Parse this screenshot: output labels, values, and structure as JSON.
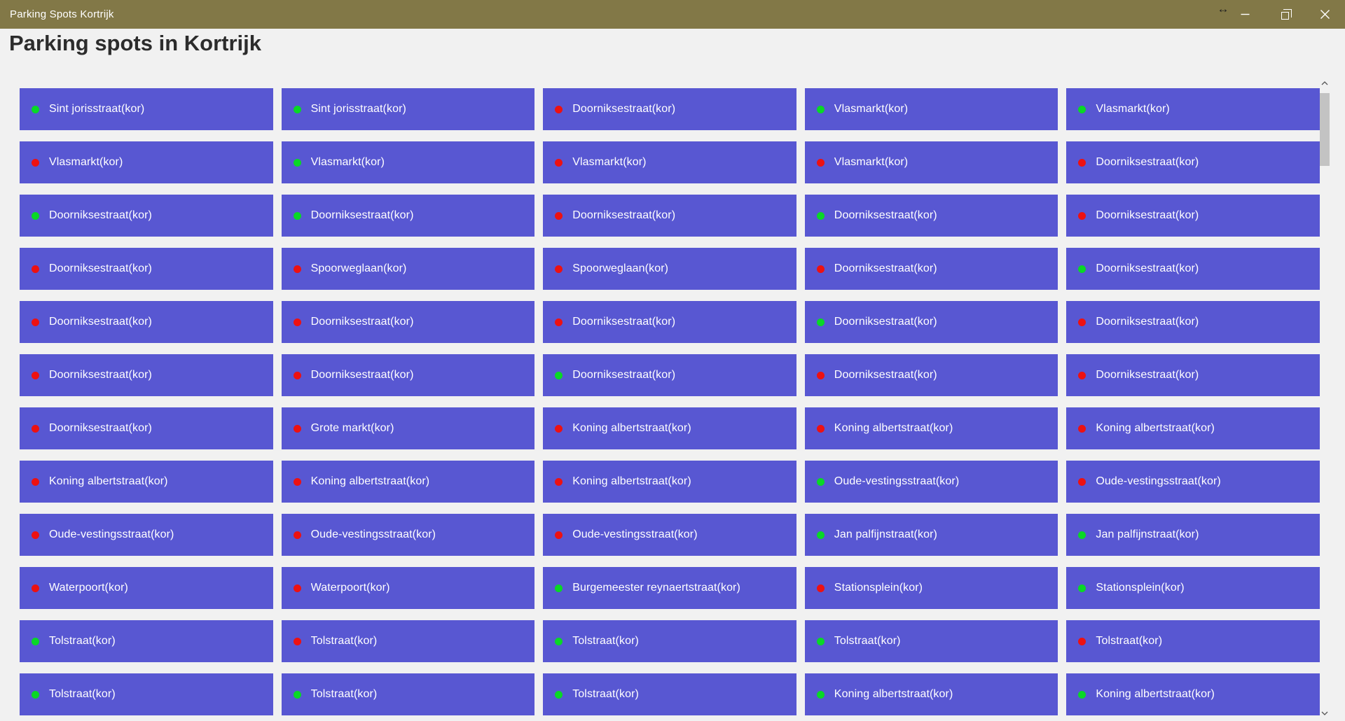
{
  "window": {
    "title": "Parking Spots Kortrijk",
    "controls": {
      "minimize": "minimize",
      "restore": "restore",
      "close": "close"
    },
    "cursor_glyph": "↔"
  },
  "page": {
    "heading": "Parking spots in Kortrijk"
  },
  "colors": {
    "titlebar": "#827847",
    "page_bg": "#f1f1f1",
    "button_bg": "#5857d2",
    "button_text": "#ffffff",
    "dot_green": "#09d826",
    "dot_red": "#ed1111",
    "scroll_thumb": "#c3c3c3"
  },
  "spots": [
    {
      "label": "Sint jorisstraat(kor)",
      "dot": "green"
    },
    {
      "label": "Sint jorisstraat(kor)",
      "dot": "green"
    },
    {
      "label": "Doorniksestraat(kor)",
      "dot": "red"
    },
    {
      "label": "Vlasmarkt(kor)",
      "dot": "green"
    },
    {
      "label": "Vlasmarkt(kor)",
      "dot": "green"
    },
    {
      "label": "Vlasmarkt(kor)",
      "dot": "red"
    },
    {
      "label": "Vlasmarkt(kor)",
      "dot": "green"
    },
    {
      "label": "Vlasmarkt(kor)",
      "dot": "red"
    },
    {
      "label": "Vlasmarkt(kor)",
      "dot": "red"
    },
    {
      "label": "Doorniksestraat(kor)",
      "dot": "red"
    },
    {
      "label": "Doorniksestraat(kor)",
      "dot": "green"
    },
    {
      "label": "Doorniksestraat(kor)",
      "dot": "green"
    },
    {
      "label": "Doorniksestraat(kor)",
      "dot": "red"
    },
    {
      "label": "Doorniksestraat(kor)",
      "dot": "green"
    },
    {
      "label": "Doorniksestraat(kor)",
      "dot": "red"
    },
    {
      "label": "Doorniksestraat(kor)",
      "dot": "red"
    },
    {
      "label": "Spoorweglaan(kor)",
      "dot": "red"
    },
    {
      "label": "Spoorweglaan(kor)",
      "dot": "red"
    },
    {
      "label": "Doorniksestraat(kor)",
      "dot": "red"
    },
    {
      "label": "Doorniksestraat(kor)",
      "dot": "green"
    },
    {
      "label": "Doorniksestraat(kor)",
      "dot": "red"
    },
    {
      "label": "Doorniksestraat(kor)",
      "dot": "red"
    },
    {
      "label": "Doorniksestraat(kor)",
      "dot": "red"
    },
    {
      "label": "Doorniksestraat(kor)",
      "dot": "green"
    },
    {
      "label": "Doorniksestraat(kor)",
      "dot": "red"
    },
    {
      "label": "Doorniksestraat(kor)",
      "dot": "red"
    },
    {
      "label": "Doorniksestraat(kor)",
      "dot": "red"
    },
    {
      "label": "Doorniksestraat(kor)",
      "dot": "green"
    },
    {
      "label": "Doorniksestraat(kor)",
      "dot": "red"
    },
    {
      "label": "Doorniksestraat(kor)",
      "dot": "red"
    },
    {
      "label": "Doorniksestraat(kor)",
      "dot": "red"
    },
    {
      "label": "Grote markt(kor)",
      "dot": "red"
    },
    {
      "label": "Koning albertstraat(kor)",
      "dot": "red"
    },
    {
      "label": "Koning albertstraat(kor)",
      "dot": "red"
    },
    {
      "label": "Koning albertstraat(kor)",
      "dot": "red"
    },
    {
      "label": "Koning albertstraat(kor)",
      "dot": "red"
    },
    {
      "label": "Koning albertstraat(kor)",
      "dot": "red"
    },
    {
      "label": "Koning albertstraat(kor)",
      "dot": "red"
    },
    {
      "label": "Oude-vestingsstraat(kor)",
      "dot": "green"
    },
    {
      "label": "Oude-vestingsstraat(kor)",
      "dot": "red"
    },
    {
      "label": "Oude-vestingsstraat(kor)",
      "dot": "red"
    },
    {
      "label": "Oude-vestingsstraat(kor)",
      "dot": "red"
    },
    {
      "label": "Oude-vestingsstraat(kor)",
      "dot": "red"
    },
    {
      "label": "Jan palfijnstraat(kor)",
      "dot": "green"
    },
    {
      "label": "Jan palfijnstraat(kor)",
      "dot": "green"
    },
    {
      "label": "Waterpoort(kor)",
      "dot": "red"
    },
    {
      "label": "Waterpoort(kor)",
      "dot": "red"
    },
    {
      "label": "Burgemeester reynaertstraat(kor)",
      "dot": "green"
    },
    {
      "label": "Stationsplein(kor)",
      "dot": "red"
    },
    {
      "label": "Stationsplein(kor)",
      "dot": "green"
    },
    {
      "label": "Tolstraat(kor)",
      "dot": "green"
    },
    {
      "label": "Tolstraat(kor)",
      "dot": "red"
    },
    {
      "label": "Tolstraat(kor)",
      "dot": "green"
    },
    {
      "label": "Tolstraat(kor)",
      "dot": "green"
    },
    {
      "label": "Tolstraat(kor)",
      "dot": "red"
    },
    {
      "label": "Tolstraat(kor)",
      "dot": "green"
    },
    {
      "label": "Tolstraat(kor)",
      "dot": "green"
    },
    {
      "label": "Tolstraat(kor)",
      "dot": "green"
    },
    {
      "label": "Koning albertstraat(kor)",
      "dot": "green"
    },
    {
      "label": "Koning albertstraat(kor)",
      "dot": "green"
    }
  ]
}
